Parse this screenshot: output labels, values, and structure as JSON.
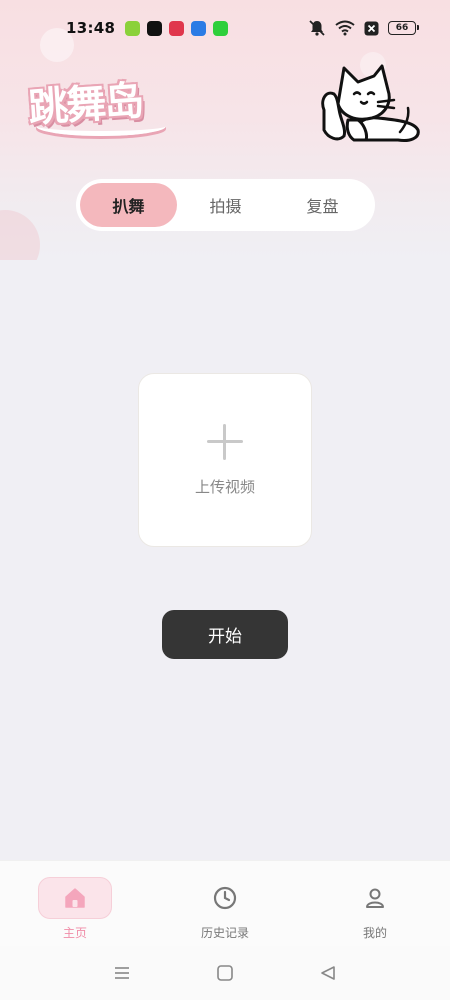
{
  "status_bar": {
    "time": "13:48",
    "battery": "66",
    "app_icons": [
      {
        "name": "app-green-icon",
        "color": "#8bd13a"
      },
      {
        "name": "app-capcut-icon",
        "color": "#111111"
      },
      {
        "name": "app-red-icon",
        "color": "#e0364c"
      },
      {
        "name": "app-blue-shield-icon",
        "color": "#2c7be5"
      },
      {
        "name": "app-green-grid-icon",
        "color": "#2fcf3b"
      }
    ]
  },
  "brand": {
    "logo_text": "跳舞岛"
  },
  "tabs": [
    {
      "label": "扒舞",
      "active": true
    },
    {
      "label": "拍摄",
      "active": false
    },
    {
      "label": "复盘",
      "active": false
    }
  ],
  "upload": {
    "label": "上传视频"
  },
  "actions": {
    "start_label": "开始"
  },
  "bottom_nav": [
    {
      "label": "主页",
      "icon": "home-icon",
      "active": true
    },
    {
      "label": "历史记录",
      "icon": "clock-icon",
      "active": false
    },
    {
      "label": "我的",
      "icon": "user-icon",
      "active": false
    }
  ],
  "colors": {
    "accent": "#f4b8bd",
    "accent_text": "#f08da8",
    "button_dark": "#353535",
    "background": "#f0eff4"
  }
}
